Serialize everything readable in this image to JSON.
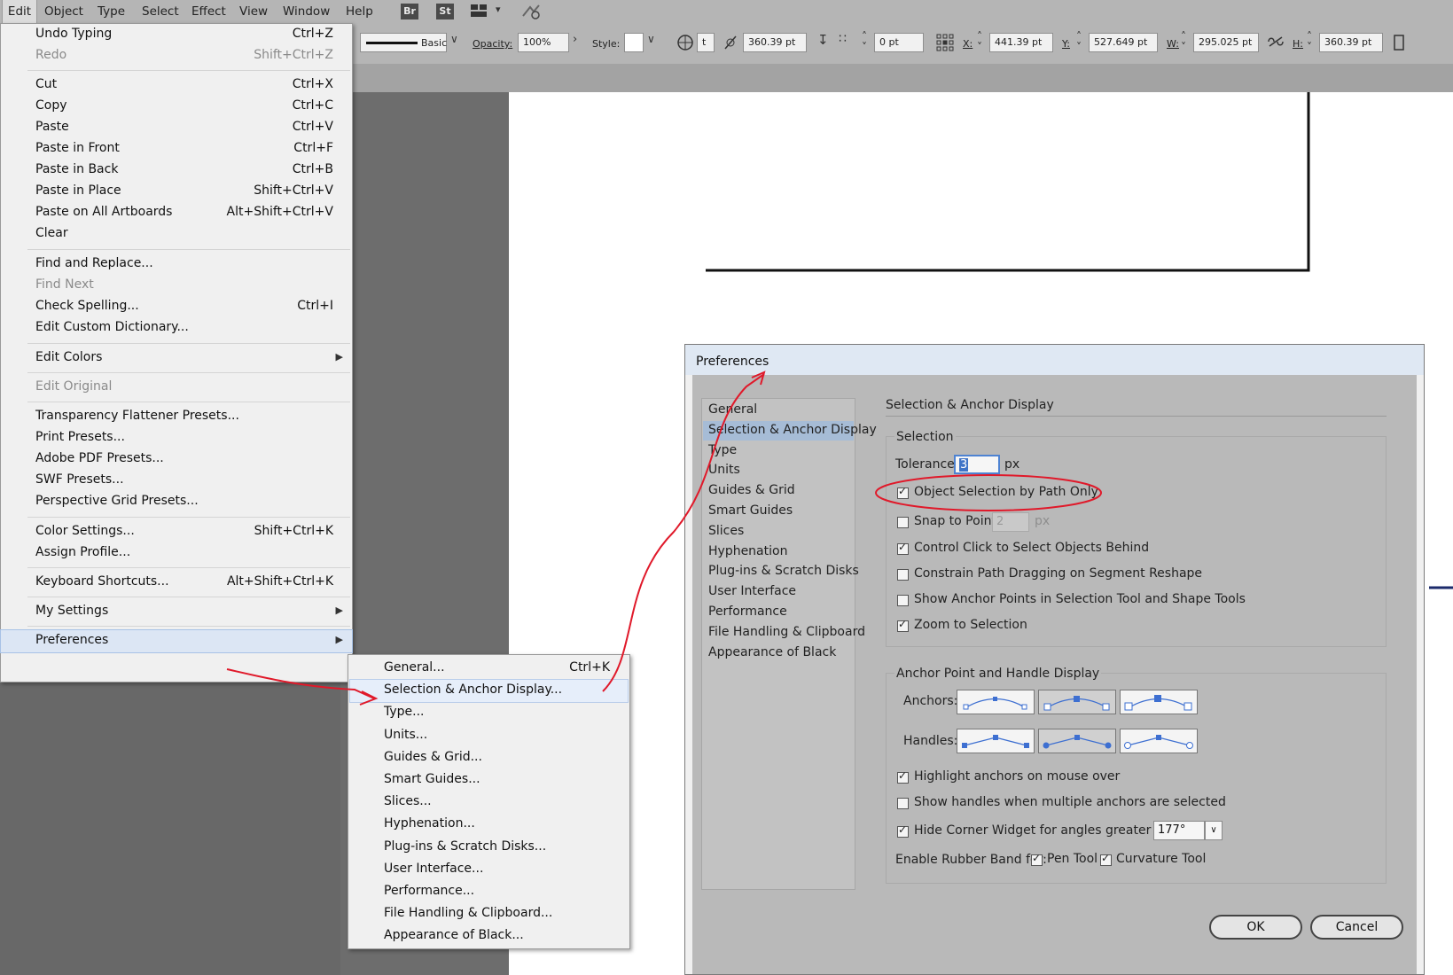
{
  "menubar": {
    "items": [
      "Edit",
      "Object",
      "Type",
      "Select",
      "Effect",
      "View",
      "Window",
      "Help"
    ],
    "icons": [
      {
        "name": "bridge-icon",
        "text": "Br"
      },
      {
        "name": "stock-icon",
        "text": "St"
      }
    ]
  },
  "control_bar": {
    "stroke_style": "Basic",
    "opacity_label": "Opacity:",
    "opacity_value": "100%",
    "style_label": "Style:",
    "fields": [
      "t",
      "360.39 pt",
      "0 pt",
      "441.39 pt",
      "527.649 pt",
      "295.025 pt",
      "360.39 pt"
    ],
    "x_label": "X:",
    "y_label": "Y:",
    "w_label": "W:",
    "h_label": "H:"
  },
  "edit_menu": {
    "items": [
      {
        "label": "Undo Typing",
        "shortcut": "Ctrl+Z"
      },
      {
        "label": "Redo",
        "shortcut": "Shift+Ctrl+Z",
        "disabled": true
      },
      {
        "label": "Cut",
        "shortcut": "Ctrl+X"
      },
      {
        "label": "Copy",
        "shortcut": "Ctrl+C"
      },
      {
        "label": "Paste",
        "shortcut": "Ctrl+V"
      },
      {
        "label": "Paste in Front",
        "shortcut": "Ctrl+F"
      },
      {
        "label": "Paste in Back",
        "shortcut": "Ctrl+B"
      },
      {
        "label": "Paste in Place",
        "shortcut": "Shift+Ctrl+V"
      },
      {
        "label": "Paste on All Artboards",
        "shortcut": "Alt+Shift+Ctrl+V"
      },
      {
        "label": "Clear",
        "shortcut": ""
      },
      {
        "label": "Find and Replace...",
        "shortcut": ""
      },
      {
        "label": "Find Next",
        "shortcut": "",
        "disabled": true
      },
      {
        "label": "Check Spelling...",
        "shortcut": "Ctrl+I"
      },
      {
        "label": "Edit Custom Dictionary...",
        "shortcut": ""
      },
      {
        "label": "Edit Colors",
        "shortcut": "",
        "submenu": true
      },
      {
        "label": "Edit Original",
        "shortcut": "",
        "disabled": true
      },
      {
        "label": "Transparency Flattener Presets...",
        "shortcut": ""
      },
      {
        "label": "Print Presets...",
        "shortcut": ""
      },
      {
        "label": "Adobe PDF Presets...",
        "shortcut": ""
      },
      {
        "label": "SWF Presets...",
        "shortcut": ""
      },
      {
        "label": "Perspective Grid Presets...",
        "shortcut": ""
      },
      {
        "label": "Color Settings...",
        "shortcut": "Shift+Ctrl+K"
      },
      {
        "label": "Assign Profile...",
        "shortcut": ""
      },
      {
        "label": "Keyboard Shortcuts...",
        "shortcut": "Alt+Shift+Ctrl+K"
      },
      {
        "label": "My Settings",
        "shortcut": "",
        "submenu": true
      },
      {
        "label": "Preferences",
        "shortcut": "",
        "submenu": true,
        "highlighted": true
      }
    ]
  },
  "preferences_submenu": {
    "items": [
      {
        "label": "General...",
        "shortcut": "Ctrl+K"
      },
      {
        "label": "Selection & Anchor Display...",
        "shortcut": "",
        "highlighted": true
      },
      {
        "label": "Type...",
        "shortcut": ""
      },
      {
        "label": "Units...",
        "shortcut": ""
      },
      {
        "label": "Guides & Grid...",
        "shortcut": ""
      },
      {
        "label": "Smart Guides...",
        "shortcut": ""
      },
      {
        "label": "Slices...",
        "shortcut": ""
      },
      {
        "label": "Hyphenation...",
        "shortcut": ""
      },
      {
        "label": "Plug-ins & Scratch Disks...",
        "shortcut": ""
      },
      {
        "label": "User Interface...",
        "shortcut": ""
      },
      {
        "label": "Performance...",
        "shortcut": ""
      },
      {
        "label": "File Handling & Clipboard...",
        "shortcut": ""
      },
      {
        "label": "Appearance of Black...",
        "shortcut": ""
      }
    ]
  },
  "dialog": {
    "title": "Preferences",
    "categories": [
      "General",
      "Selection & Anchor Display",
      "Type",
      "Units",
      "Guides & Grid",
      "Smart Guides",
      "Slices",
      "Hyphenation",
      "Plug-ins & Scratch Disks",
      "User Interface",
      "Performance",
      "File Handling & Clipboard",
      "Appearance of Black"
    ],
    "selected_category": "Selection & Anchor Display",
    "section_title": "Selection & Anchor Display",
    "selection": {
      "group_label": "Selection",
      "tolerance_label": "Tolerance:",
      "tolerance_value": "3",
      "tolerance_unit": "px",
      "object_selection_label": "Object Selection by Path Only",
      "snap_label": "Snap to Point",
      "snap_value": "2",
      "snap_unit": "px",
      "control_click_label": "Control Click to Select Objects Behind",
      "constrain_label": "Constrain Path Dragging on Segment Reshape",
      "show_anchor_label": "Show Anchor Points in Selection Tool and Shape Tools",
      "zoom_label": "Zoom to Selection"
    },
    "anchor_display": {
      "group_label": "Anchor Point and Handle Display",
      "anchors_label": "Anchors:",
      "handles_label": "Handles:",
      "highlight_label": "Highlight anchors on mouse over",
      "show_handles_label": "Show handles when multiple anchors are selected",
      "hide_corner_label": "Hide Corner Widget for angles greater than:",
      "hide_corner_value": "177°",
      "rubber_band_label": "Enable Rubber Band for:",
      "pen_tool_label": "Pen Tool",
      "curvature_tool_label": "Curvature Tool"
    },
    "ok_label": "OK",
    "cancel_label": "Cancel"
  },
  "colors": {
    "annotation": "#e0192a",
    "selection": "#a6bcd6",
    "menu_highlight": "#dce6f4"
  }
}
